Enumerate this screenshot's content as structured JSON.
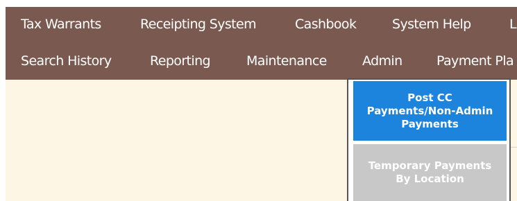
{
  "nav": {
    "row1": [
      {
        "label": "Tax Warrants"
      },
      {
        "label": "Receipting System"
      },
      {
        "label": "Cashbook"
      },
      {
        "label": "System Help"
      },
      {
        "label": "L"
      }
    ],
    "row2": [
      {
        "label": "Search History"
      },
      {
        "label": "Reporting"
      },
      {
        "label": "Maintenance"
      },
      {
        "label": "Admin"
      },
      {
        "label": "Payment Pla"
      }
    ]
  },
  "dropdown": {
    "items": [
      {
        "label": "Post CC Payments/Non-Admin Payments",
        "state": "highlighted"
      },
      {
        "label": "Temporary Payments By Location",
        "state": "normal"
      }
    ]
  },
  "colors": {
    "nav_background": "#7a5a50",
    "nav_text": "#ffffff",
    "content_background": "#fdf6e5",
    "dropdown_highlight": "#1d84dd",
    "dropdown_normal": "#c8c8c8",
    "dropdown_border": "#555555"
  }
}
